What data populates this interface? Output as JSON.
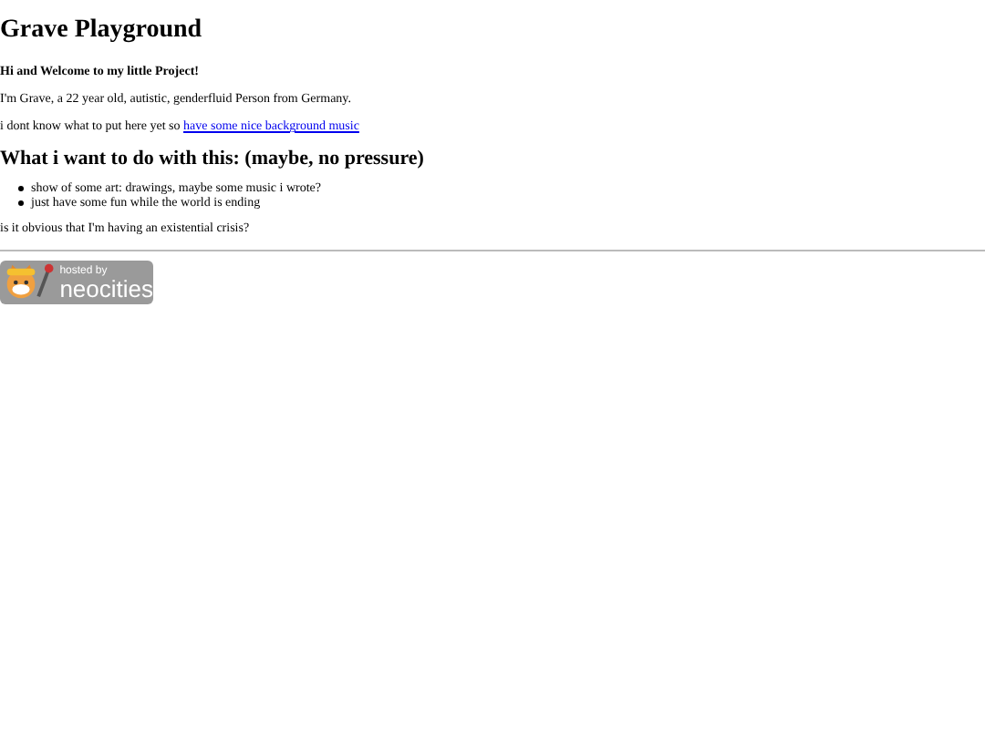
{
  "title": "Grave Playground",
  "welcome": "Hi and Welcome to my little Project!",
  "intro": "I'm Grave, a 22 year old, autistic, genderfluid Person from Germany.",
  "music_line": {
    "text": "i dont know what to put here yet so",
    "link": "have some nice background music"
  },
  "subheading": "What i want to do with this: (maybe, no pressure)",
  "goals": [
    "show of some art: drawings, maybe some music i wrote?",
    "just have some fun while the world is ending"
  ],
  "closing": "is it obvious that I'm having an existential crisis?",
  "badge": {
    "small": "hosted by",
    "big": "neocities"
  }
}
